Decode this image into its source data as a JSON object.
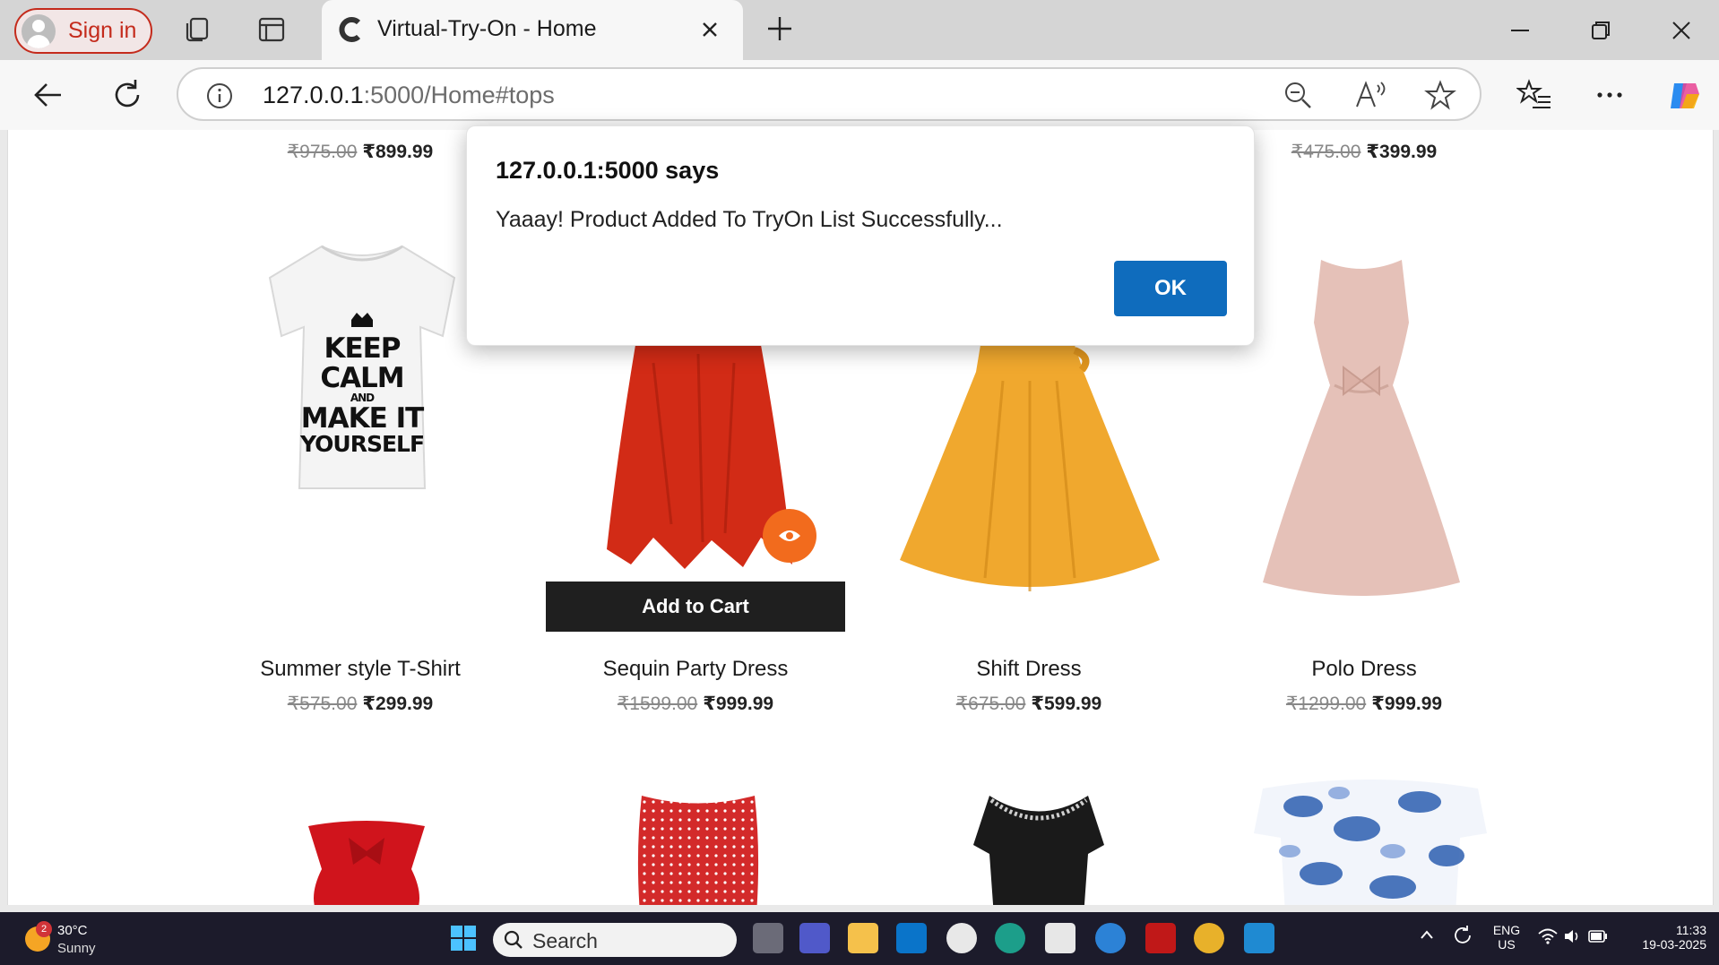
{
  "browser": {
    "signin_label": "Sign in",
    "tab_title": "Virtual-Try-On - Home",
    "url_host": "127.0.0.1",
    "url_path": ":5000/Home#tops"
  },
  "products_top_row_prices": [
    {
      "old": "₹975.00",
      "new": "₹899.99"
    },
    {
      "old": "₹475.00",
      "new": "₹399.99"
    }
  ],
  "products": [
    {
      "name": "Summer style T-Shirt",
      "old": "₹575.00",
      "new": "₹299.99",
      "shirt_text": [
        "KEEP",
        "CALM",
        "AND",
        "MAKE IT",
        "YOURSELF"
      ]
    },
    {
      "name": "Sequin Party Dress",
      "old": "₹1599.00",
      "new": "₹999.99"
    },
    {
      "name": "Shift Dress",
      "old": "₹675.00",
      "new": "₹599.99"
    },
    {
      "name": "Polo Dress",
      "old": "₹1299.00",
      "new": "₹999.99"
    }
  ],
  "product_actions": {
    "add_to_cart": "Add to Cart"
  },
  "dialog": {
    "title": "127.0.0.1:5000 says",
    "message": "Yaaay! Product Added To TryOn List Successfully...",
    "ok_label": "OK"
  },
  "taskbar": {
    "temperature": "30°C",
    "condition": "Sunny",
    "weather_badge": "2",
    "search_label": "Search",
    "lang_top": "ENG",
    "lang_bottom": "US",
    "time": "11:33",
    "date": "19-03-2025"
  },
  "colors": {
    "accent_blue": "#0f6cbd",
    "eye_button": "#f26b1d",
    "cart_button": "#1f1f1f",
    "signin_red": "#c42b1c"
  }
}
